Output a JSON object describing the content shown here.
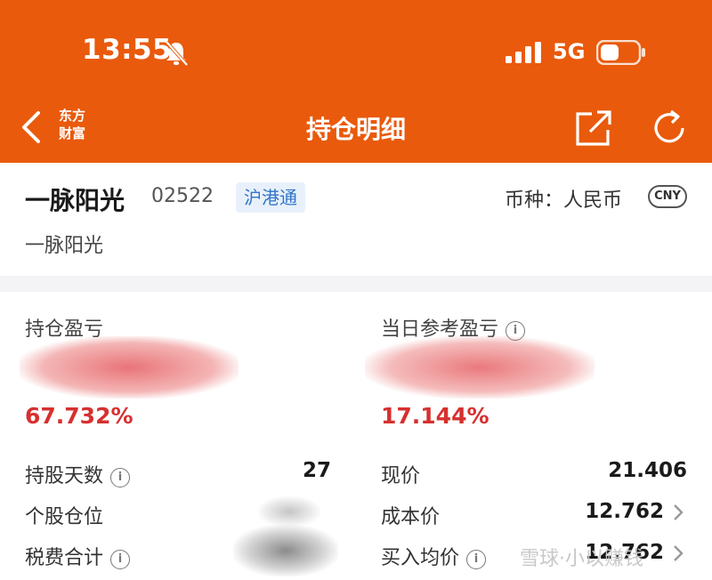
{
  "status": {
    "time": "13:55",
    "network": "5G"
  },
  "nav": {
    "title": "持仓明细",
    "logo_line1": "东方",
    "logo_line2": "财富"
  },
  "stock": {
    "name": "一脉阳光",
    "code": "02522",
    "market_tag": "沪港通",
    "currency_label": "币种：人民币",
    "currency_badge": "CNY",
    "subtitle": "一脉阳光"
  },
  "pnl": {
    "position_label": "持仓盈亏",
    "position_pct": "67.732%",
    "today_label": "当日参考盈亏",
    "today_pct": "17.144%"
  },
  "info_glyph": "i",
  "details_left": [
    {
      "label": "持股天数",
      "value": "27",
      "info": true
    },
    {
      "label": "个股仓位",
      "value": "",
      "info": false
    },
    {
      "label": "税费合计",
      "value": "",
      "info": true
    }
  ],
  "details_right": [
    {
      "label": "现价",
      "value": "21.406"
    },
    {
      "label": "成本价",
      "value": "12.762"
    },
    {
      "label": "买入均价",
      "value": "12.762"
    }
  ],
  "watermark": "雪球·小以赚钱",
  "colors": {
    "brand": "#e95a0c",
    "loss_gain_red": "#d6302f",
    "tag_blue": "#2f74c7"
  }
}
